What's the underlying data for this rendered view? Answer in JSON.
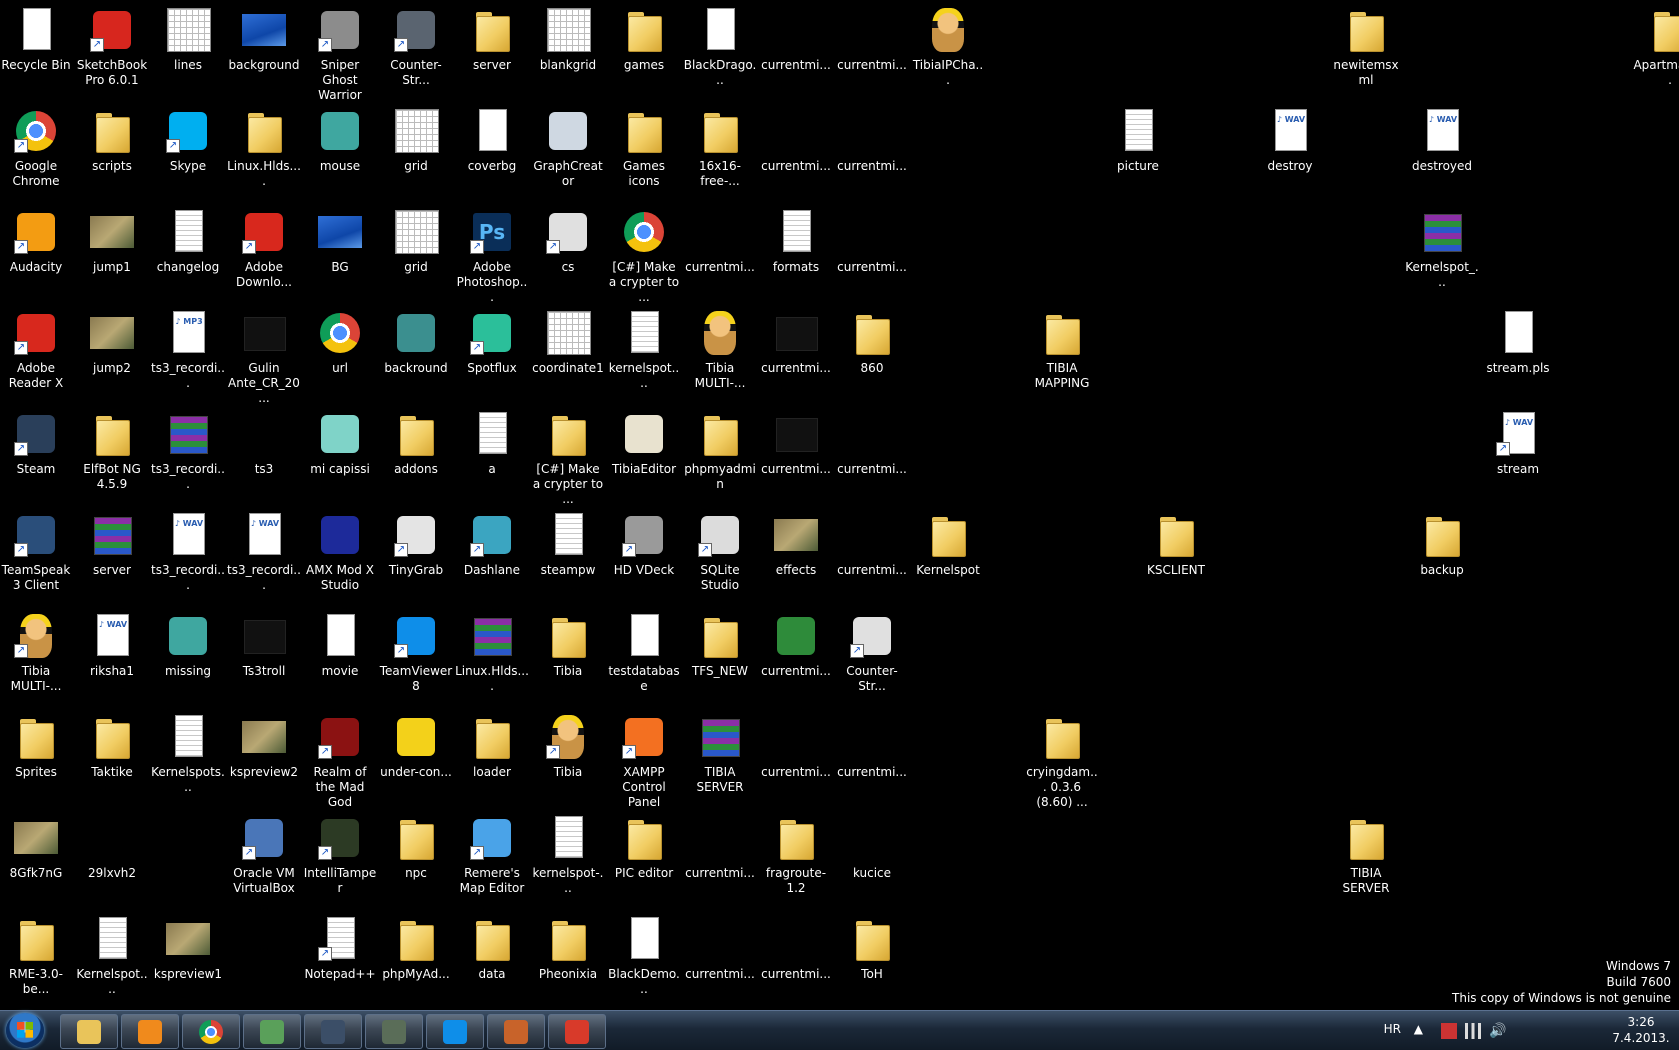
{
  "icons": [
    {
      "label": "Recycle Bin",
      "col": 0,
      "row": 0,
      "icon": "recycle-bin-icon",
      "style": "doc"
    },
    {
      "label": "SketchBook Pro 6.0.1",
      "col": 1,
      "row": 0,
      "icon": "sketchbook-icon",
      "style": "app",
      "color": "#d7261e",
      "shortcut": true
    },
    {
      "label": "lines",
      "col": 2,
      "row": 0,
      "icon": "grid-image-icon",
      "style": "grid"
    },
    {
      "label": "background",
      "col": 3,
      "row": 0,
      "icon": "image-file-icon",
      "style": "blueimg"
    },
    {
      "label": "Sniper Ghost Warrior",
      "col": 4,
      "row": 0,
      "icon": "crosshair-icon",
      "style": "app",
      "color": "#8c8c8c",
      "shortcut": true
    },
    {
      "label": "Counter-Str...",
      "col": 5,
      "row": 0,
      "icon": "counter-strike-icon",
      "style": "app",
      "color": "#5a6470",
      "shortcut": true
    },
    {
      "label": "server",
      "col": 6,
      "row": 0,
      "icon": "folder-icon",
      "style": "folder"
    },
    {
      "label": "blankgrid",
      "col": 7,
      "row": 0,
      "icon": "grid-image-icon",
      "style": "grid"
    },
    {
      "label": "games",
      "col": 8,
      "row": 0,
      "icon": "folder-icon",
      "style": "folder"
    },
    {
      "label": "BlackDrago...",
      "col": 9,
      "row": 0,
      "icon": "file-icon",
      "style": "doc"
    },
    {
      "label": "currentmi...",
      "col": 10,
      "row": 0,
      "icon": "image-file-icon",
      "style": "blank"
    },
    {
      "label": "currentmi...",
      "col": 11,
      "row": 0,
      "icon": "image-file-icon",
      "style": "blank"
    },
    {
      "label": "TibiaIPCha...",
      "col": 12,
      "row": 0,
      "icon": "tibia-icon",
      "style": "face"
    },
    {
      "label": "newitemsxml",
      "col": 17.5,
      "row": 0,
      "icon": "folder-icon",
      "style": "folder"
    },
    {
      "label": "Apartman_...",
      "col": 21.5,
      "row": 0,
      "icon": "folder-icon",
      "style": "folder"
    },
    {
      "label": "Google Chrome",
      "col": 0,
      "row": 1,
      "icon": "chrome-icon",
      "style": "chrome",
      "shortcut": true
    },
    {
      "label": "scripts",
      "col": 1,
      "row": 1,
      "icon": "folder-icon",
      "style": "folder"
    },
    {
      "label": "Skype",
      "col": 2,
      "row": 1,
      "icon": "skype-icon",
      "style": "app",
      "color": "#00aff0",
      "shortcut": true
    },
    {
      "label": "Linux.Hlds....",
      "col": 3,
      "row": 1,
      "icon": "folder-icon",
      "style": "folder"
    },
    {
      "label": "mouse",
      "col": 4,
      "row": 1,
      "icon": "installer-icon",
      "style": "app",
      "color": "#3fa7a0"
    },
    {
      "label": "grid",
      "col": 5,
      "row": 1,
      "icon": "grid-image-icon",
      "style": "grid"
    },
    {
      "label": "coverbg",
      "col": 6,
      "row": 1,
      "icon": "image-file-icon",
      "style": "doc"
    },
    {
      "label": "GraphCreator",
      "col": 7,
      "row": 1,
      "icon": "graphcreator-icon",
      "style": "app",
      "color": "#cfd8e2"
    },
    {
      "label": "Games icons",
      "col": 8,
      "row": 1,
      "icon": "folder-icon",
      "style": "folder"
    },
    {
      "label": "16x16-free-...",
      "col": 9,
      "row": 1,
      "icon": "folder-icon",
      "style": "folder"
    },
    {
      "label": "currentmi...",
      "col": 10,
      "row": 1,
      "icon": "image-file-icon",
      "style": "blank"
    },
    {
      "label": "currentmi...",
      "col": 11,
      "row": 1,
      "icon": "image-file-icon",
      "style": "blank"
    },
    {
      "label": "picture",
      "col": 14.5,
      "row": 1,
      "icon": "file-icon",
      "style": "textdoc"
    },
    {
      "label": "destroy",
      "col": 16.5,
      "row": 1,
      "icon": "wav-file-icon",
      "style": "wav"
    },
    {
      "label": "destroyed",
      "col": 18.5,
      "row": 1,
      "icon": "wav-file-icon",
      "style": "wav"
    },
    {
      "label": "Audacity",
      "col": 0,
      "row": 2,
      "icon": "audacity-icon",
      "style": "app",
      "color": "#f39c12",
      "shortcut": true
    },
    {
      "label": "jump1",
      "col": 1,
      "row": 2,
      "icon": "image-file-icon",
      "style": "img"
    },
    {
      "label": "changelog",
      "col": 2,
      "row": 2,
      "icon": "document-icon",
      "style": "textdoc"
    },
    {
      "label": "Adobe Downlo...",
      "col": 3,
      "row": 2,
      "icon": "adobe-icon",
      "style": "app",
      "color": "#d8281d",
      "shortcut": true
    },
    {
      "label": "BG",
      "col": 4,
      "row": 2,
      "icon": "image-file-icon",
      "style": "blueimg"
    },
    {
      "label": "grid",
      "col": 5,
      "row": 2,
      "icon": "grid-image-icon",
      "style": "grid"
    },
    {
      "label": "Adobe Photoshop...",
      "col": 6,
      "row": 2,
      "icon": "photoshop-icon",
      "style": "ps",
      "shortcut": true
    },
    {
      "label": "cs",
      "col": 7,
      "row": 2,
      "icon": "counter-strike-icon",
      "style": "app",
      "color": "#e0e0e0",
      "shortcut": true
    },
    {
      "label": "[C#] Make a crypter to ...",
      "col": 8,
      "row": 2,
      "icon": "chrome-icon",
      "style": "chrome"
    },
    {
      "label": "currentmi...",
      "col": 9,
      "row": 2,
      "icon": "image-file-icon",
      "style": "blank"
    },
    {
      "label": "formats",
      "col": 10,
      "row": 2,
      "icon": "document-icon",
      "style": "textdoc"
    },
    {
      "label": "currentmi...",
      "col": 11,
      "row": 2,
      "icon": "image-file-icon",
      "style": "blank"
    },
    {
      "label": "Kernelspot_...",
      "col": 18.5,
      "row": 2,
      "icon": "rar-archive-icon",
      "style": "rar"
    },
    {
      "label": "Adobe Reader X",
      "col": 0,
      "row": 3,
      "icon": "adobe-reader-icon",
      "style": "app",
      "color": "#d8281d",
      "shortcut": true
    },
    {
      "label": "jump2",
      "col": 1,
      "row": 3,
      "icon": "image-file-icon",
      "style": "img"
    },
    {
      "label": "ts3_recordi...",
      "col": 2,
      "row": 3,
      "icon": "mp3-file-icon",
      "style": "mp3"
    },
    {
      "label": "Gulin Ante_CR_20...",
      "col": 3,
      "row": 3,
      "icon": "image-file-icon",
      "style": "dark"
    },
    {
      "label": "url",
      "col": 4,
      "row": 3,
      "icon": "chrome-icon",
      "style": "chrome"
    },
    {
      "label": "backround",
      "col": 5,
      "row": 3,
      "icon": "image-file-icon",
      "style": "app",
      "color": "#3b8f8f"
    },
    {
      "label": "Spotflux",
      "col": 6,
      "row": 3,
      "icon": "spotflux-icon",
      "style": "app",
      "color": "#2bbf9a",
      "shortcut": true
    },
    {
      "label": "coordinate1",
      "col": 7,
      "row": 3,
      "icon": "grid-image-icon",
      "style": "grid"
    },
    {
      "label": "kernelspot....",
      "col": 8,
      "row": 3,
      "icon": "document-icon",
      "style": "textdoc"
    },
    {
      "label": "Tibia MULTI-...",
      "col": 9,
      "row": 3,
      "icon": "tibia-icon",
      "style": "face"
    },
    {
      "label": "currentmi...",
      "col": 10,
      "row": 3,
      "icon": "image-file-icon",
      "style": "dark"
    },
    {
      "label": "860",
      "col": 11,
      "row": 3,
      "icon": "folder-icon",
      "style": "folder"
    },
    {
      "label": "TIBIA MAPPING",
      "col": 13.5,
      "row": 3,
      "icon": "folder-icon",
      "style": "folder"
    },
    {
      "label": "stream.pls",
      "col": 19.5,
      "row": 3,
      "icon": "file-icon",
      "style": "doc"
    },
    {
      "label": "Steam",
      "col": 0,
      "row": 4,
      "icon": "steam-icon",
      "style": "app",
      "color": "#2a3f5a",
      "shortcut": true
    },
    {
      "label": "ElfBot NG 4.5.9",
      "col": 1,
      "row": 4,
      "icon": "folder-icon",
      "style": "folder"
    },
    {
      "label": "ts3_recordi...",
      "col": 2,
      "row": 4,
      "icon": "rar-archive-icon",
      "style": "rar"
    },
    {
      "label": "ts3",
      "col": 3,
      "row": 4,
      "icon": "image-file-icon",
      "style": "blank"
    },
    {
      "label": "mi capissi",
      "col": 4,
      "row": 4,
      "icon": "image-file-icon",
      "style": "app",
      "color": "#7fd3c8"
    },
    {
      "label": "addons",
      "col": 5,
      "row": 4,
      "icon": "folder-icon",
      "style": "folder"
    },
    {
      "label": "a",
      "col": 6,
      "row": 4,
      "icon": "document-icon",
      "style": "textdoc"
    },
    {
      "label": "[C#] Make a crypter to ...",
      "col": 7,
      "row": 4,
      "icon": "folder-icon",
      "style": "folder"
    },
    {
      "label": "TibiaEditor",
      "col": 8,
      "row": 4,
      "icon": "skull-icon",
      "style": "app",
      "color": "#e8e2cf"
    },
    {
      "label": "phpmyadmin",
      "col": 9,
      "row": 4,
      "icon": "folder-icon",
      "style": "folder"
    },
    {
      "label": "currentmi...",
      "col": 10,
      "row": 4,
      "icon": "image-file-icon",
      "style": "dark"
    },
    {
      "label": "currentmi...",
      "col": 11,
      "row": 4,
      "icon": "image-file-icon",
      "style": "blank"
    },
    {
      "label": "stream",
      "col": 19.5,
      "row": 4,
      "icon": "media-playlist-icon",
      "style": "wav",
      "shortcut": true
    },
    {
      "label": "TeamSpeak 3 Client",
      "col": 0,
      "row": 5,
      "icon": "teamspeak-icon",
      "style": "app",
      "color": "#2a4e7a",
      "shortcut": true
    },
    {
      "label": "server",
      "col": 1,
      "row": 5,
      "icon": "rar-archive-icon",
      "style": "rar"
    },
    {
      "label": "ts3_recordi...",
      "col": 2,
      "row": 5,
      "icon": "wav-file-icon",
      "style": "wav"
    },
    {
      "label": "ts3_recordi...",
      "col": 3,
      "row": 5,
      "icon": "wav-file-icon",
      "style": "wav"
    },
    {
      "label": "AMX Mod X Studio",
      "col": 4,
      "row": 5,
      "icon": "amx-icon",
      "style": "app",
      "color": "#1d2a9a"
    },
    {
      "label": "TinyGrab",
      "col": 5,
      "row": 5,
      "icon": "cloud-icon",
      "style": "app",
      "color": "#e4e4e4",
      "shortcut": true
    },
    {
      "label": "Dashlane",
      "col": 6,
      "row": 5,
      "icon": "dashlane-icon",
      "style": "app",
      "color": "#3ba5c1",
      "shortcut": true
    },
    {
      "label": "steampw",
      "col": 7,
      "row": 5,
      "icon": "document-icon",
      "style": "textdoc"
    },
    {
      "label": "HD VDeck",
      "col": 8,
      "row": 5,
      "icon": "hd-vdeck-icon",
      "style": "app",
      "color": "#9a9a9a",
      "shortcut": true
    },
    {
      "label": "SQLite Studio",
      "col": 9,
      "row": 5,
      "icon": "database-icon",
      "style": "app",
      "color": "#dcdcdc",
      "shortcut": true
    },
    {
      "label": "effects",
      "col": 10,
      "row": 5,
      "icon": "image-file-icon",
      "style": "img"
    },
    {
      "label": "currentmi...",
      "col": 11,
      "row": 5,
      "icon": "image-file-icon",
      "style": "blank"
    },
    {
      "label": "Kernelspot",
      "col": 12,
      "row": 5,
      "icon": "folder-icon",
      "style": "folder"
    },
    {
      "label": "KSCLIENT",
      "col": 15,
      "row": 5,
      "icon": "folder-icon",
      "style": "folder"
    },
    {
      "label": "backup",
      "col": 18.5,
      "row": 5,
      "icon": "folder-icon",
      "style": "folder"
    },
    {
      "label": "Tibia MULTI-...",
      "col": 0,
      "row": 6,
      "icon": "tibia-icon",
      "style": "face",
      "shortcut": true
    },
    {
      "label": "riksha1",
      "col": 1,
      "row": 6,
      "icon": "wav-file-icon",
      "style": "wav"
    },
    {
      "label": "missing",
      "col": 2,
      "row": 6,
      "icon": "installer-icon",
      "style": "app",
      "color": "#3fa7a0"
    },
    {
      "label": "Ts3troll",
      "col": 3,
      "row": 6,
      "icon": "video-file-icon",
      "style": "dark"
    },
    {
      "label": "movie",
      "col": 4,
      "row": 6,
      "icon": "movie-file-icon",
      "style": "doc"
    },
    {
      "label": "TeamViewer 8",
      "col": 5,
      "row": 6,
      "icon": "teamviewer-icon",
      "style": "app",
      "color": "#0e8ee9",
      "shortcut": true
    },
    {
      "label": "Linux.Hlds....",
      "col": 6,
      "row": 6,
      "icon": "rar-archive-icon",
      "style": "rar"
    },
    {
      "label": "Tibia",
      "col": 7,
      "row": 6,
      "icon": "folder-icon",
      "style": "folder"
    },
    {
      "label": "testdatabase",
      "col": 8,
      "row": 6,
      "icon": "file-icon",
      "style": "doc"
    },
    {
      "label": "TFS_NEW",
      "col": 9,
      "row": 6,
      "icon": "folder-icon",
      "style": "folder"
    },
    {
      "label": "currentmi...",
      "col": 10,
      "row": 6,
      "icon": "image-file-icon",
      "style": "app",
      "color": "#2e8b3a"
    },
    {
      "label": "Counter-Str...",
      "col": 11,
      "row": 6,
      "icon": "counter-strike-icon",
      "style": "app",
      "color": "#e0e0e0",
      "shortcut": true
    },
    {
      "label": "Sprites",
      "col": 0,
      "row": 7,
      "icon": "folder-icon",
      "style": "folder"
    },
    {
      "label": "Taktike",
      "col": 1,
      "row": 7,
      "icon": "folder-icon",
      "style": "folder"
    },
    {
      "label": "Kernelspots...",
      "col": 2,
      "row": 7,
      "icon": "document-icon",
      "style": "textdoc"
    },
    {
      "label": "kspreview2",
      "col": 3,
      "row": 7,
      "icon": "image-file-icon",
      "style": "img"
    },
    {
      "label": "Realm of the Mad God",
      "col": 4,
      "row": 7,
      "icon": "realm-icon",
      "style": "app",
      "color": "#8b1212",
      "shortcut": true
    },
    {
      "label": "under-con...",
      "col": 5,
      "row": 7,
      "icon": "under-construction-icon",
      "style": "app",
      "color": "#f3d11a"
    },
    {
      "label": "loader",
      "col": 6,
      "row": 7,
      "icon": "folder-icon",
      "style": "folder"
    },
    {
      "label": "Tibia",
      "col": 7,
      "row": 7,
      "icon": "tibia-character-icon",
      "style": "face",
      "shortcut": true
    },
    {
      "label": "XAMPP Control Panel",
      "col": 8,
      "row": 7,
      "icon": "xampp-icon",
      "style": "app",
      "color": "#f37021",
      "shortcut": true
    },
    {
      "label": "TIBIA SERVER",
      "col": 9,
      "row": 7,
      "icon": "rar-archive-icon",
      "style": "rar"
    },
    {
      "label": "currentmi...",
      "col": 10,
      "row": 7,
      "icon": "image-file-icon",
      "style": "blank"
    },
    {
      "label": "currentmi...",
      "col": 11,
      "row": 7,
      "icon": "image-file-icon",
      "style": "blank"
    },
    {
      "label": "cryingdam... 0.3.6 (8.60) ...",
      "col": 13.5,
      "row": 7,
      "icon": "folder-icon",
      "style": "folder"
    },
    {
      "label": "8Gfk7nG",
      "col": 0,
      "row": 8,
      "icon": "image-file-icon",
      "style": "img"
    },
    {
      "label": "29lxvh2",
      "col": 1,
      "row": 8,
      "icon": "image-file-icon",
      "style": "blank"
    },
    {
      "label": "Oracle VM VirtualBox",
      "col": 3,
      "row": 8,
      "icon": "virtualbox-icon",
      "style": "app",
      "color": "#4a76b8",
      "shortcut": true
    },
    {
      "label": "IntelliTamper",
      "col": 4,
      "row": 8,
      "icon": "intellitamper-icon",
      "style": "app",
      "color": "#2c3a24",
      "shortcut": true
    },
    {
      "label": "npc",
      "col": 5,
      "row": 8,
      "icon": "folder-icon",
      "style": "folder"
    },
    {
      "label": "Remere's Map Editor",
      "col": 6,
      "row": 8,
      "icon": "palette-icon",
      "style": "app",
      "color": "#4aa3e8",
      "shortcut": true
    },
    {
      "label": "kernelspot-...",
      "col": 7,
      "row": 8,
      "icon": "document-icon",
      "style": "textdoc"
    },
    {
      "label": "PIC editor",
      "col": 8,
      "row": 8,
      "icon": "folder-icon",
      "style": "folder"
    },
    {
      "label": "currentmi...",
      "col": 9,
      "row": 8,
      "icon": "image-file-icon",
      "style": "blank"
    },
    {
      "label": "fragroute-1.2",
      "col": 10,
      "row": 8,
      "icon": "folder-icon",
      "style": "folder"
    },
    {
      "label": "kucice",
      "col": 11,
      "row": 8,
      "icon": "image-file-icon",
      "style": "blank"
    },
    {
      "label": "TIBIA SERVER",
      "col": 17.5,
      "row": 8,
      "icon": "folder-icon",
      "style": "folder"
    },
    {
      "label": "RME-3.0-be...",
      "col": 0,
      "row": 9,
      "icon": "folder-icon",
      "style": "folder"
    },
    {
      "label": "Kernelspot....",
      "col": 1,
      "row": 9,
      "icon": "document-icon",
      "style": "textdoc"
    },
    {
      "label": "kspreview1",
      "col": 2,
      "row": 9,
      "icon": "image-file-icon",
      "style": "img"
    },
    {
      "label": "Notepad++",
      "col": 4,
      "row": 9,
      "icon": "notepad-plus-icon",
      "style": "textdoc",
      "shortcut": true
    },
    {
      "label": "phpMyAd...",
      "col": 5,
      "row": 9,
      "icon": "folder-icon",
      "style": "folder"
    },
    {
      "label": "data",
      "col": 6,
      "row": 9,
      "icon": "folder-icon",
      "style": "folder"
    },
    {
      "label": "Pheonixia",
      "col": 7,
      "row": 9,
      "icon": "folder-icon",
      "style": "folder"
    },
    {
      "label": "BlackDemo...",
      "col": 8,
      "row": 9,
      "icon": "file-icon",
      "style": "doc"
    },
    {
      "label": "currentmi...",
      "col": 9,
      "row": 9,
      "icon": "image-file-icon",
      "style": "blank"
    },
    {
      "label": "currentmi...",
      "col": 10,
      "row": 9,
      "icon": "image-file-icon",
      "style": "blank"
    },
    {
      "label": "ToH",
      "col": 11,
      "row": 9,
      "icon": "folder-icon",
      "style": "folder"
    }
  ],
  "watermark": {
    "line1": "Windows 7",
    "line2": "Build 7600",
    "line3": "This copy of Windows is not genuine"
  },
  "taskbar": {
    "buttons": [
      {
        "name": "windows-explorer",
        "icon": "folder-icon",
        "color": "#e9c45a"
      },
      {
        "name": "media-player",
        "icon": "media-player-icon",
        "color": "#f08a1c"
      },
      {
        "name": "google-chrome",
        "icon": "chrome-icon",
        "color": "#db4437"
      },
      {
        "name": "app-green",
        "icon": "app-icon",
        "color": "#5aa05a"
      },
      {
        "name": "app-sword",
        "icon": "sword-icon",
        "color": "#3b4e67"
      },
      {
        "name": "app-monitor",
        "icon": "monitor-icon",
        "color": "#5a6d58"
      },
      {
        "name": "teamviewer",
        "icon": "teamviewer-icon",
        "color": "#0e8ee9"
      },
      {
        "name": "app-squirrel",
        "icon": "squirrel-icon",
        "color": "#c8632a"
      },
      {
        "name": "tibia",
        "icon": "tibia-icon",
        "color": "#d83a2a"
      }
    ],
    "tray": {
      "language": "HR",
      "time": "3:26",
      "date": "7.4.2013."
    }
  }
}
